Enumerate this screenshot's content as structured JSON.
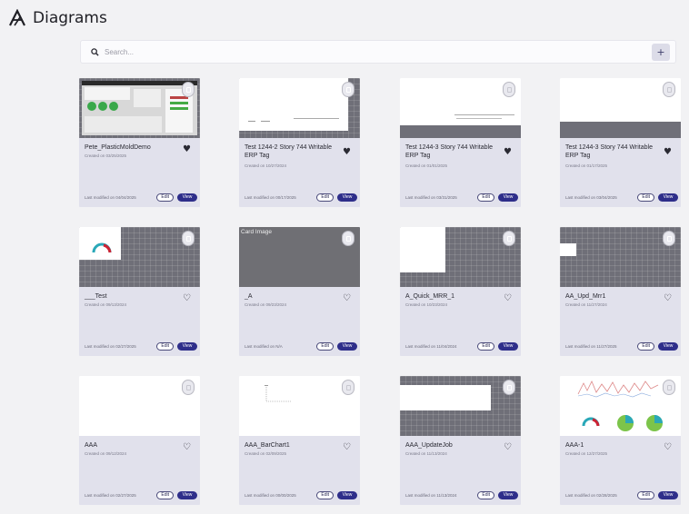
{
  "header": {
    "title": "Diagrams",
    "logo_icon": "logo-a-icon"
  },
  "search": {
    "placeholder": "Search...",
    "add_label": "+"
  },
  "labels": {
    "edit": "Edit",
    "view": "View"
  },
  "cards": [
    {
      "title": "Pete_PlasticMoldDemo",
      "created": "Created on 03/25/2025",
      "modified": "Last modified on 04/04/2025",
      "favorite": true,
      "thumb_style": "screenshot"
    },
    {
      "title": "Test 1244-2 Story 744 Writable ERP Tag",
      "created": "Created on 10/27/2024",
      "modified": "Last modified on 00/17/2025",
      "favorite": true,
      "thumb_style": "white-doc"
    },
    {
      "title": "Test 1244-3 Story 744 Writable ERP Tag",
      "created": "Created on 01/01/2025",
      "modified": "Last modified on 03/31/2025",
      "favorite": true,
      "thumb_style": "white-doc-gray-lock"
    },
    {
      "title": "Test 1244-3 Story 744 Writable ERP Tag",
      "created": "Created on 01/17/2025",
      "modified": "Last modified on 03/04/2025",
      "favorite": true,
      "thumb_style": "white-top-gray-lock"
    },
    {
      "title": "___Test",
      "created": "Created on 09/13/2024",
      "modified": "Last modified on 02/27/2025",
      "favorite": false,
      "thumb_style": "gauge"
    },
    {
      "title": "_A",
      "created": "Created on 09/23/2024",
      "modified": "Last modified on N/A",
      "favorite": false,
      "thumb_style": "broken-image",
      "broken_alt": "Card Image"
    },
    {
      "title": "A_Quick_MRR_1",
      "created": "Created on 10/23/2024",
      "modified": "Last modified on 11/04/2024",
      "favorite": false,
      "thumb_style": "white-left"
    },
    {
      "title": "AA_Upd_Mrr1",
      "created": "Created on 11/27/2024",
      "modified": "Last modified on 11/27/2025",
      "favorite": false,
      "thumb_style": "small-white"
    },
    {
      "title": "AAA",
      "created": "Created on 09/12/2024",
      "modified": "Last modified on 02/27/2025",
      "favorite": false,
      "thumb_style": "white-gray-lock"
    },
    {
      "title": "AAA_BarChart1",
      "created": "Created on 02/09/2025",
      "modified": "Last modified on 00/00/2025",
      "favorite": false,
      "thumb_style": "barchart"
    },
    {
      "title": "AAA_UpdateJob",
      "created": "Created on 11/13/2024",
      "modified": "Last modified on 11/13/2024",
      "favorite": false,
      "thumb_style": "white-rect"
    },
    {
      "title": "AAA-1",
      "created": "Created on 12/27/2025",
      "modified": "Last modified on 02/28/2025",
      "favorite": false,
      "thumb_style": "dashboard"
    }
  ],
  "colors": {
    "accent": "#2e2e8a",
    "card_bg": "#e1e1ec",
    "thumb_gray": "#6f6f78"
  }
}
